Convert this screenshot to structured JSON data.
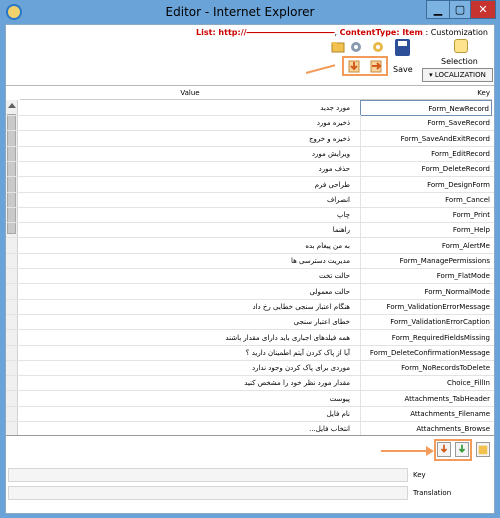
{
  "window": {
    "title": "Editor - Internet Explorer",
    "minimize_label": "▁",
    "maximize_label": "▢",
    "close_label": "✕"
  },
  "breadcrumb": {
    "list_prefix": "List: http://",
    "list_value": "———————————",
    "content_type": "ContentType: Item",
    "separator": ":",
    "scope": "Customization"
  },
  "toolbar": {
    "save_label": "Save",
    "selection_label": "Selection",
    "localization_label": "▾  LOCALIZATION"
  },
  "grid": {
    "columns": {
      "value": "Value",
      "key": "Key"
    },
    "rows": [
      {
        "value": "مورد جدید",
        "key": "Form_NewRecord"
      },
      {
        "value": "ذخیره مورد",
        "key": "Form_SaveRecord"
      },
      {
        "value": "ذخیره و خروج",
        "key": "Form_SaveAndExitRecord"
      },
      {
        "value": "ویرایش مورد",
        "key": "Form_EditRecord"
      },
      {
        "value": "حذف مورد",
        "key": "Form_DeleteRecord"
      },
      {
        "value": "طراحی فرم",
        "key": "Form_DesignForm"
      },
      {
        "value": "انصراف",
        "key": "Form_Cancel"
      },
      {
        "value": "چاپ",
        "key": "Form_Print"
      },
      {
        "value": "راهنما",
        "key": "Form_Help"
      },
      {
        "value": "به من پیغام بده",
        "key": "Form_AlertMe"
      },
      {
        "value": "مدیریت دسترسی ها",
        "key": "Form_ManagePermissions"
      },
      {
        "value": "حالت تخت",
        "key": "Form_FlatMode"
      },
      {
        "value": "حالت معمولی",
        "key": "Form_NormalMode"
      },
      {
        "value": "هنگام اعتبار سنجی خطایی رخ داد",
        "key": "Form_ValidationErrorMessage"
      },
      {
        "value": "خطای اعتبار سنجی",
        "key": "Form_ValidationErrorCaption"
      },
      {
        "value": "همه فیلدهای اجباری باید دارای مقدار باشند",
        "key": "Form_RequiredFieldsMissing"
      },
      {
        "value": "آیا از پاک کردن آیتم اطمینان دارید ؟",
        "key": "Form_DeleteConfirmationMessage"
      },
      {
        "value": "موردی برای پاک کردن وجود ندارد",
        "key": "Form_NoRecordsToDelete"
      },
      {
        "value": "مقدار مورد نظر خود را مشخص کنید",
        "key": "Choice_FillIn"
      },
      {
        "value": "پیوست",
        "key": "Attachments_TabHeader"
      },
      {
        "value": "نام فایل",
        "key": "Attachments_Filename"
      },
      {
        "value": "انتخاب فایل...",
        "key": "Attachments_Browse"
      }
    ]
  },
  "editor": {
    "key_label": "Key",
    "translation_label": "Translation",
    "key_value": "",
    "translation_value": ""
  },
  "colors": {
    "title_bar": "#6aa3d8",
    "highlight": "#f39b5a",
    "close": "#c7332f"
  }
}
